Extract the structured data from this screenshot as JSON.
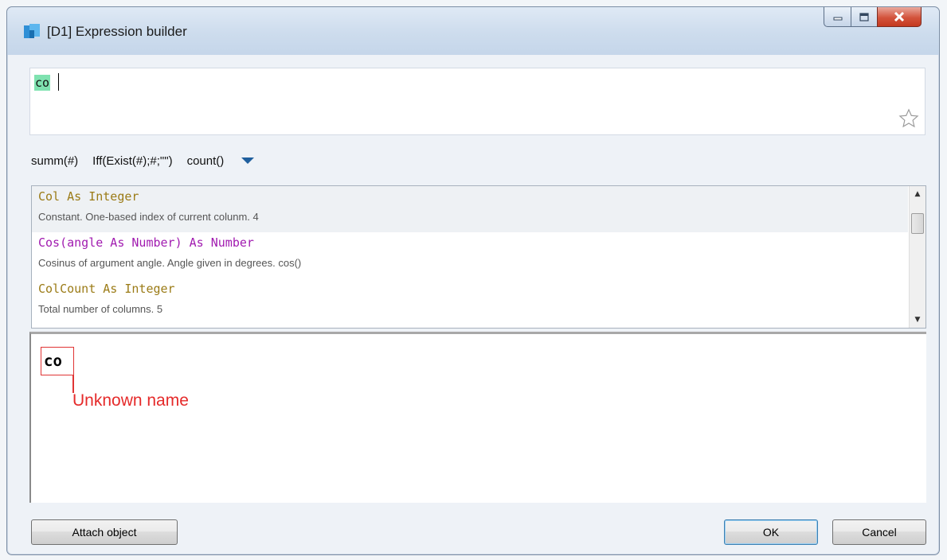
{
  "window": {
    "title": "[D1] Expression builder",
    "controls": {
      "minimize": "minimize-icon",
      "maximize": "maximize-icon",
      "close": "close-icon"
    }
  },
  "expression": {
    "value": "co"
  },
  "quick_functions": [
    "summ(#)",
    "Iff(Exist(#);#;\"\")",
    "count()"
  ],
  "suggestions": [
    {
      "signature": "Col As Integer",
      "description": "Constant. One-based index of current colunm. 4",
      "color": "#9b7b16"
    },
    {
      "signature": "Cos(angle As Number) As Number",
      "description": "Cosinus of argument angle. Angle given in degrees. cos()",
      "color": "#a11bb0"
    },
    {
      "signature": "ColCount As Integer",
      "description": "Total number of columns. 5",
      "color": "#9b7b16"
    }
  ],
  "error": {
    "token": "co",
    "message": "Unknown name",
    "color": "#e52a2a"
  },
  "buttons": {
    "attach": "Attach object",
    "ok": "OK",
    "cancel": "Cancel"
  },
  "colors": {
    "highlight": "#7fe2b0",
    "dropdown_arrow": "#1f5f9e"
  }
}
